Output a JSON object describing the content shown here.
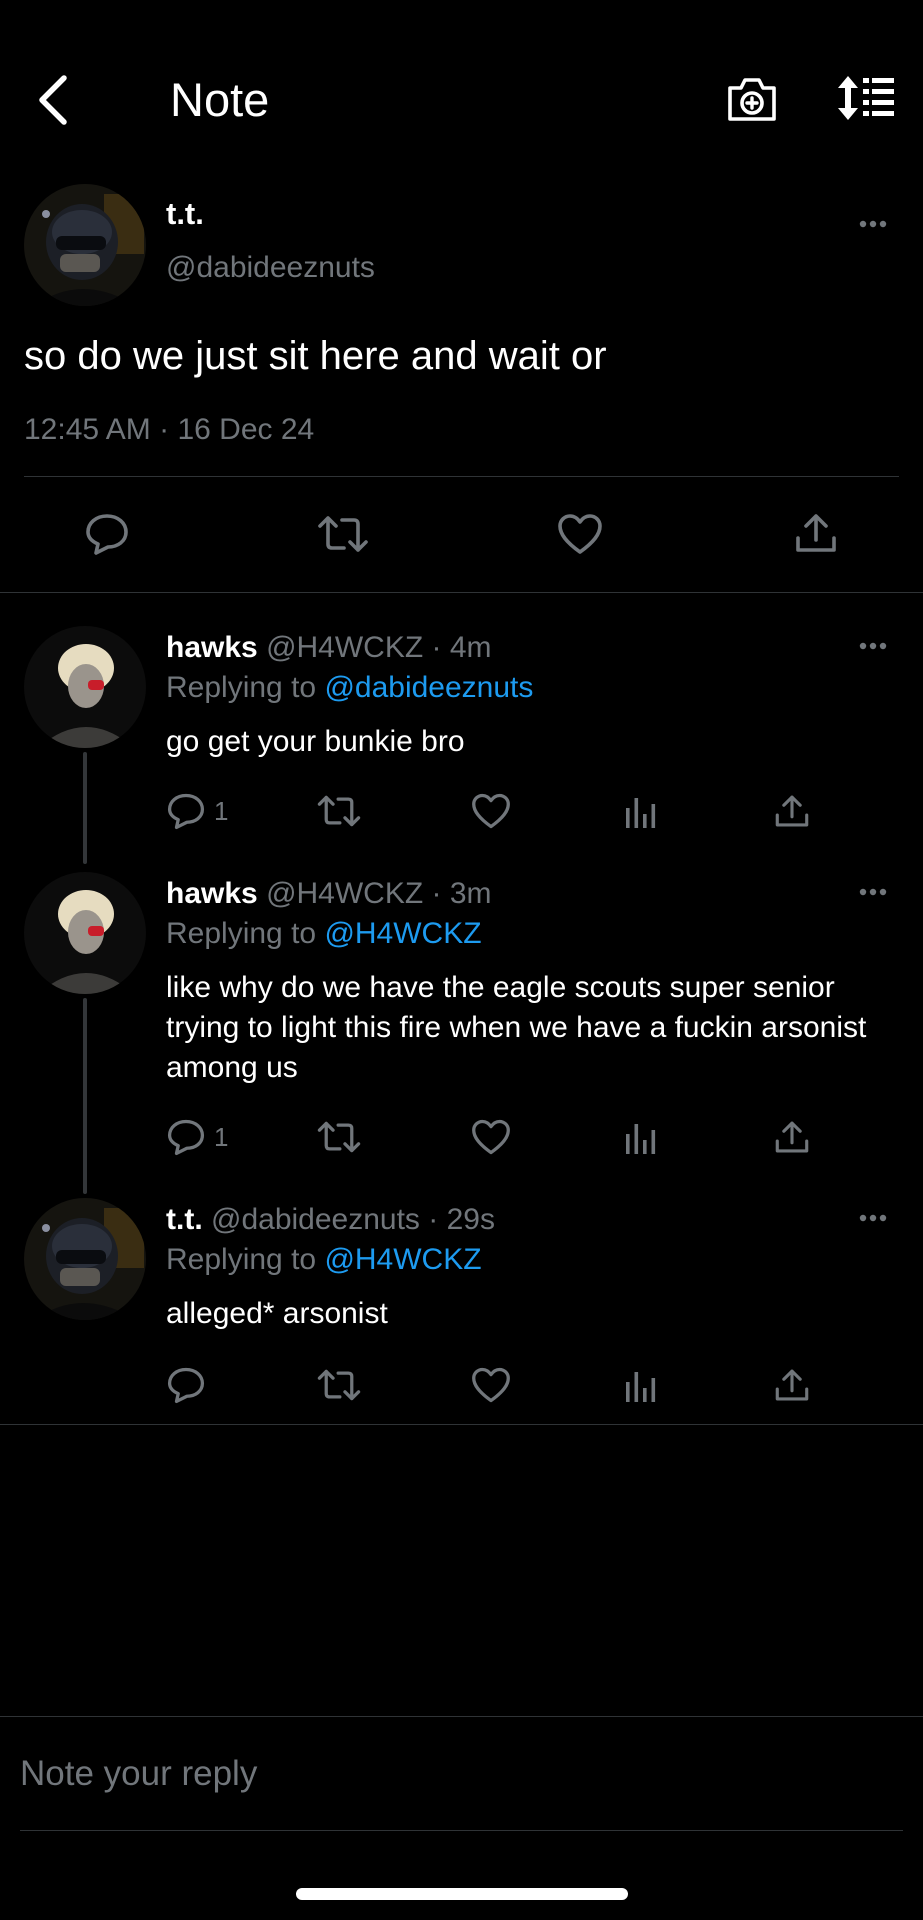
{
  "header": {
    "title": "Note"
  },
  "note": {
    "display_name": "t.t.",
    "handle": "@dabideeznuts",
    "text": "so do we just sit here and wait or",
    "time": "12:45 AM",
    "date": "16 Dec 24",
    "separator": "·"
  },
  "replies": [
    {
      "name": "hawks",
      "handle": "@H4WCKZ",
      "time": "4m",
      "replying_prefix": "Replying to",
      "replying_to": "@dabideeznuts",
      "text": "go get your bunkie bro",
      "reply_count": "1",
      "avatar": "hawks-avatar"
    },
    {
      "name": "hawks",
      "handle": "@H4WCKZ",
      "time": "3m",
      "replying_prefix": "Replying to",
      "replying_to": "@H4WCKZ",
      "text": "like why do we have the eagle scouts super senior trying to light this fire when we have a fuckin arsonist among us",
      "reply_count": "1",
      "avatar": "hawks-avatar"
    },
    {
      "name": "t.t.",
      "handle": "@dabideeznuts",
      "time": "29s",
      "replying_prefix": "Replying to",
      "replying_to": "@H4WCKZ",
      "text": "alleged* arsonist",
      "reply_count": "",
      "avatar": "tt-avatar"
    }
  ],
  "composer": {
    "placeholder": "Note your reply"
  },
  "icons": [
    "back-icon",
    "camera-plus-icon",
    "sort-icon",
    "reply-icon",
    "renote-icon",
    "like-icon",
    "share-icon",
    "analytics-icon",
    "more-icon"
  ],
  "colors": {
    "background": "#000000",
    "link": "#1d9bf0",
    "muted": "#71767b",
    "divider": "#2f3336"
  }
}
